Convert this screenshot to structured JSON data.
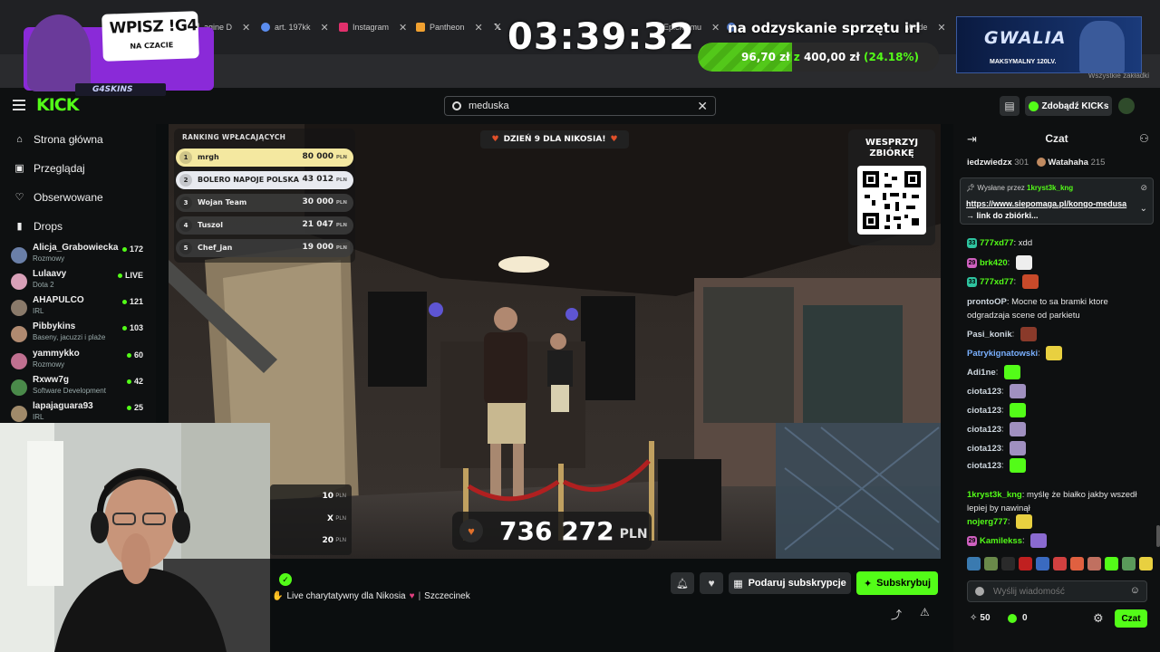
{
  "browser": {
    "tabs": [
      {
        "label": "agine D",
        "color": "#888888"
      },
      {
        "label": "art. 197kk",
        "color": "#5b8def"
      },
      {
        "label": "Instagram",
        "color": "#e1306c"
      },
      {
        "label": "Pantheon",
        "color": "#f0a030"
      },
      {
        "label": "",
        "color": "#ffffff"
      },
      {
        "label": "Epicka mu",
        "color": "#888888"
      },
      {
        "label": "",
        "color": "#5b8def"
      },
      {
        "label": "Wode",
        "color": "#888888"
      }
    ],
    "bookmarks_label": "Wszystkie zakładki"
  },
  "overlay": {
    "promo_title": "WPISZ !G4",
    "promo_subtitle": "NA CZACIE",
    "promo_brand": "G4SKINS",
    "timer": "03:39:32",
    "goal_title": "na odzyskanie sprzętu irl",
    "goal_current": "96,70 zł",
    "goal_z": "z",
    "goal_target": "400,00 zł",
    "goal_pct": "(24.18%)",
    "goal_progress": 0.2418,
    "gwalia_title": "GWALIA",
    "gwalia_sub": "MAKSYMALNY 120LV."
  },
  "header": {
    "logo": "KICK",
    "search_value": "meduska",
    "kicks_button": "Zdobądź KICKs"
  },
  "sidebar": {
    "nav": [
      {
        "label": "Strona główna",
        "icon": "home-icon",
        "glyph": "⌂"
      },
      {
        "label": "Przeglądaj",
        "icon": "browse-icon",
        "glyph": "▣"
      },
      {
        "label": "Obserwowane",
        "icon": "heart-icon",
        "glyph": "♡"
      },
      {
        "label": "Drops",
        "icon": "drops-icon",
        "glyph": "▮"
      }
    ],
    "channels": [
      {
        "name": "Alicja_Grabowiecka",
        "category": "Rozmowy",
        "viewers": "172",
        "color": "#6a7fa8"
      },
      {
        "name": "Lulaavy",
        "category": "Dota 2",
        "viewers": "LIVE",
        "color": "#d8a0b8"
      },
      {
        "name": "AHAPULCO",
        "category": "IRL",
        "viewers": "121",
        "color": "#8a7a6a"
      },
      {
        "name": "Pibbykins",
        "category": "Baseny, jacuzzi i plaże",
        "viewers": "103",
        "color": "#b08a70"
      },
      {
        "name": "yammykko",
        "category": "Rozmowy",
        "viewers": "60",
        "color": "#c07090"
      },
      {
        "name": "Rxww7g",
        "category": "Software Development",
        "viewers": "42",
        "color": "#4a8a4a"
      },
      {
        "name": "lapajaguara93",
        "category": "IRL",
        "viewers": "25",
        "color": "#a08a6a"
      }
    ]
  },
  "video": {
    "ranking_title": "RANKING WPŁACAJĄCYCH",
    "ranking": [
      {
        "rank": "1",
        "name": "mrgh",
        "amount": "80 000",
        "unit": "PLN"
      },
      {
        "rank": "2",
        "name": "BOLERO NAPOJE POLSKA",
        "amount": "43 012",
        "unit": "PLN"
      },
      {
        "rank": "3",
        "name": "Wojan Team",
        "amount": "30 000",
        "unit": "PLN"
      },
      {
        "rank": "4",
        "name": "Tuszol",
        "amount": "21 047",
        "unit": "PLN"
      },
      {
        "rank": "5",
        "name": "Chef_jan",
        "amount": "19 000",
        "unit": "PLN"
      }
    ],
    "day_banner": "DZIEŃ 9 DLA NIKOSIA!",
    "qr_title_1": "WESPRZYJ",
    "qr_title_2": "ZBIÓRKĘ",
    "total_amount": "736 272",
    "total_unit": "PLN",
    "mini_rows": [
      {
        "val": "10",
        "unit": "PLN"
      },
      {
        "val": "X",
        "unit": "PLN"
      },
      {
        "val": "20",
        "unit": "PLN"
      }
    ]
  },
  "stream": {
    "title": "Live charytatywny dla Nikosia",
    "location": "Szczecinek",
    "gift_sub_button": "Podaruj subskrypcje",
    "subscribe_button": "Subskrybuj"
  },
  "chat": {
    "title": "Czat",
    "top_gifters": [
      {
        "name": "iedzwiedzx",
        "count": "301"
      },
      {
        "name": "Watahaha",
        "count": "215"
      }
    ],
    "pinned_by_label": "Wysłane przez",
    "pinned_by_user": "1kryst3k_kng",
    "pinned_link": "https://www.siepomaga.pl/kongo-medusa",
    "pinned_suffix": "→ link do zbiórki...",
    "messages": [
      {
        "user": "777xd77",
        "text": "xdd",
        "color": "#53fc18",
        "badge": "33",
        "emote": ""
      },
      {
        "user": "brk420",
        "text": "",
        "color": "#53fc18",
        "badge": "29",
        "emote": "#eeeeee"
      },
      {
        "user": "777xd77",
        "text": "",
        "color": "#53fc18",
        "badge": "33",
        "emote": "#c84a2a"
      },
      {
        "user": "prontoOP",
        "text": "Mocne to sa bramki ktore odgradzaja scene od parkietu",
        "color": "#cfd8e0",
        "badge": "",
        "emote": ""
      },
      {
        "user": "Pasi_konik",
        "text": "",
        "color": "#cfd8e0",
        "badge": "",
        "emote": "#8a3a2a"
      },
      {
        "user": "Patrykignatowski",
        "text": "",
        "color": "#7ab0ff",
        "badge": "",
        "emote": "#e8d040"
      },
      {
        "user": "Adi1ne",
        "text": "",
        "color": "#cfd8e0",
        "badge": "",
        "emote": "#53fc18"
      },
      {
        "user": "ciota123",
        "text": "",
        "color": "#cfd8e0",
        "badge": "",
        "emote": "#a090c0"
      },
      {
        "user": "ciota123",
        "text": "",
        "color": "#cfd8e0",
        "badge": "",
        "emote": "#53fc18"
      },
      {
        "user": "ciota123",
        "text": "",
        "color": "#cfd8e0",
        "badge": "",
        "emote": "#a090c0"
      },
      {
        "user": "ciota123",
        "text": "",
        "color": "#cfd8e0",
        "badge": "",
        "emote": "#a090c0"
      },
      {
        "user": "ciota123",
        "text": "",
        "color": "#cfd8e0",
        "badge": "",
        "emote": "#53fc18"
      },
      {
        "user": "1kryst3k_kng",
        "text": "myślę że białko jakby wszedł lepiej by nawinął",
        "color": "#53fc18",
        "badge": "",
        "emote": ""
      },
      {
        "user": "nojerg777",
        "text": "",
        "color": "#53fc18",
        "badge": "",
        "emote": "#e8d040"
      },
      {
        "user": "Kamilekss",
        "text": "",
        "color": "#53fc18",
        "badge": "29",
        "emote": "#8a6ad0"
      }
    ],
    "input_placeholder": "Wyślij wiadomość",
    "points": "50",
    "kicks": "0",
    "send_button": "Czat"
  },
  "colors": {
    "accent": "#53fc18",
    "bg": "#0b0e0f",
    "panel": "#0e1011"
  }
}
